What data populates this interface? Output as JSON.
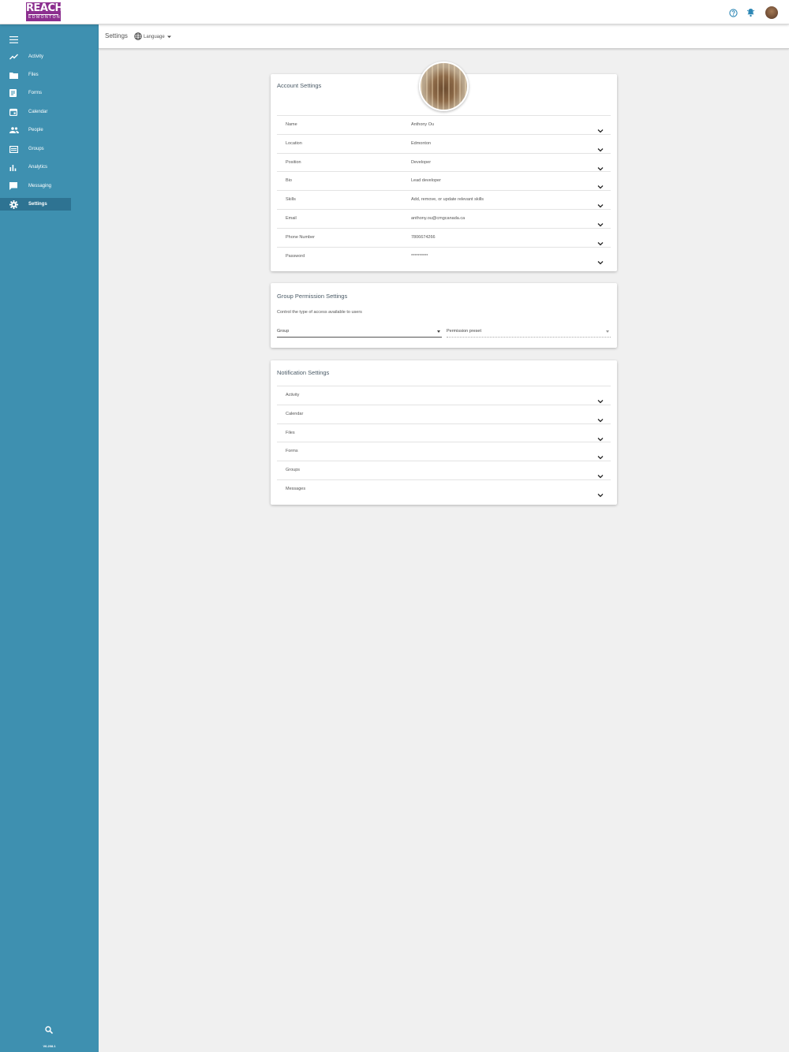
{
  "header": {
    "logo_main": "REACH",
    "logo_sub": "EDMONTON",
    "icons": [
      "help-circle-icon",
      "bell-icon",
      "user-avatar"
    ]
  },
  "sidebar": {
    "items": [
      {
        "label": "Activity",
        "icon": "activity-icon"
      },
      {
        "label": "Files",
        "icon": "folder-icon"
      },
      {
        "label": "Forms",
        "icon": "form-icon"
      },
      {
        "label": "Calendar",
        "icon": "calendar-icon"
      },
      {
        "label": "People",
        "icon": "people-icon"
      },
      {
        "label": "Groups",
        "icon": "groups-icon"
      },
      {
        "label": "Analytics",
        "icon": "bar-chart-icon"
      },
      {
        "label": "Messaging",
        "icon": "chat-icon"
      },
      {
        "label": "Settings",
        "icon": "gear-icon"
      }
    ],
    "active": "Settings",
    "version": "V6.208.1",
    "bg_color": "#3e90b0"
  },
  "subheader": {
    "title": "Settings",
    "language_label": "Language"
  },
  "account": {
    "title": "Account Settings",
    "rows": [
      {
        "key": "Name",
        "value": "Anthony Ou"
      },
      {
        "key": "Location",
        "value": "Edmonton"
      },
      {
        "key": "Position",
        "value": "Developer"
      },
      {
        "key": "Bio",
        "value": "Lead developer"
      },
      {
        "key": "Skills",
        "value": "Add, remove, or update relevant skills"
      },
      {
        "key": "Email",
        "value": "anthony.ou@cmgcanada.ca"
      },
      {
        "key": "Phone Number",
        "value": "7806674266"
      },
      {
        "key": "Password",
        "value": "**********"
      }
    ]
  },
  "group_permissions": {
    "title": "Group Permission Settings",
    "description": "Control the type of access available to users",
    "group_label": "Group",
    "preset_label": "Permission preset"
  },
  "notifications": {
    "title": "Notification Settings",
    "rows": [
      "Activity",
      "Calendar",
      "Files",
      "Forms",
      "Groups",
      "Messages"
    ]
  }
}
